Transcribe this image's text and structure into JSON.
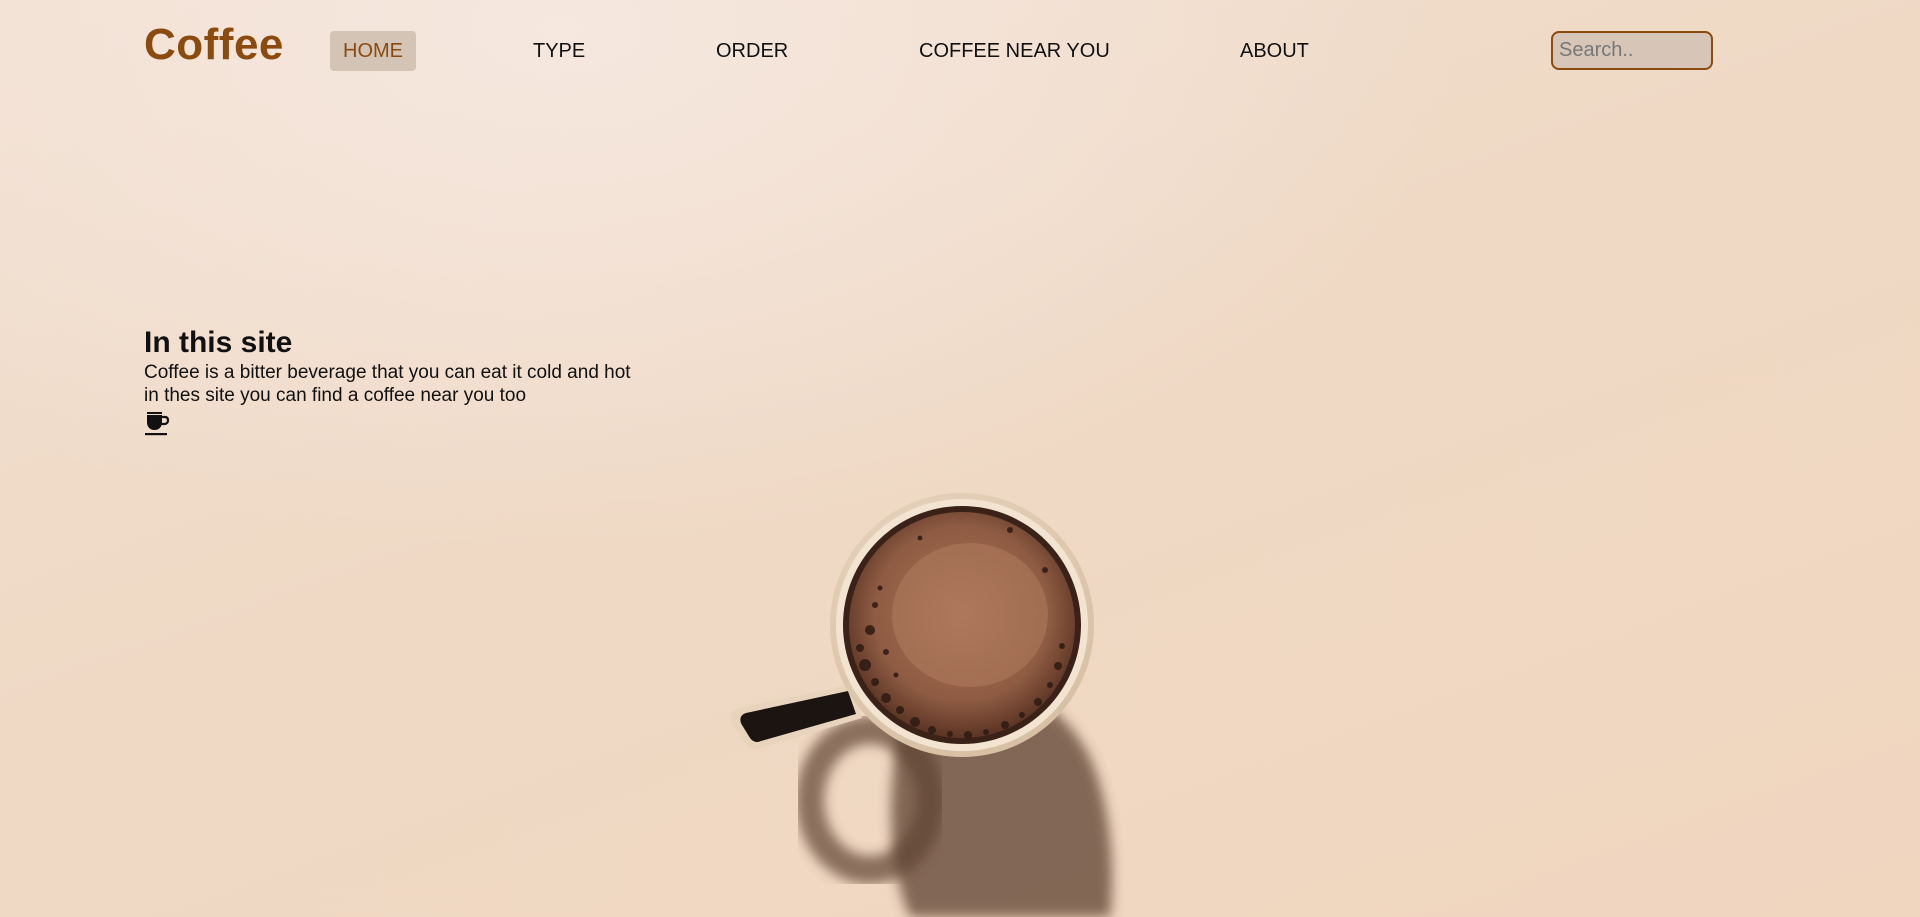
{
  "header": {
    "brand": "Coffee",
    "nav": [
      {
        "label": "HOME",
        "active": true
      },
      {
        "label": "TYPE",
        "active": false
      },
      {
        "label": "ORDER",
        "active": false
      },
      {
        "label": "COFFEE NEAR YOU",
        "active": false
      },
      {
        "label": "ABOUT",
        "active": false
      }
    ],
    "search": {
      "placeholder": "Search..",
      "value": ""
    }
  },
  "intro": {
    "heading": "In this site",
    "line1": "Coffee is a bitter beverage that you can eat it cold and hot",
    "line2": "in thes site you can find a coffee near you too",
    "icon": "coffee-cup-icon"
  },
  "hero_image": {
    "subject": "coffee-mug-top-view"
  },
  "colors": {
    "brand": "#8b4a0e",
    "background": "#f0dac7",
    "active_nav_bg": "#d2c1b3",
    "text": "#111111"
  }
}
